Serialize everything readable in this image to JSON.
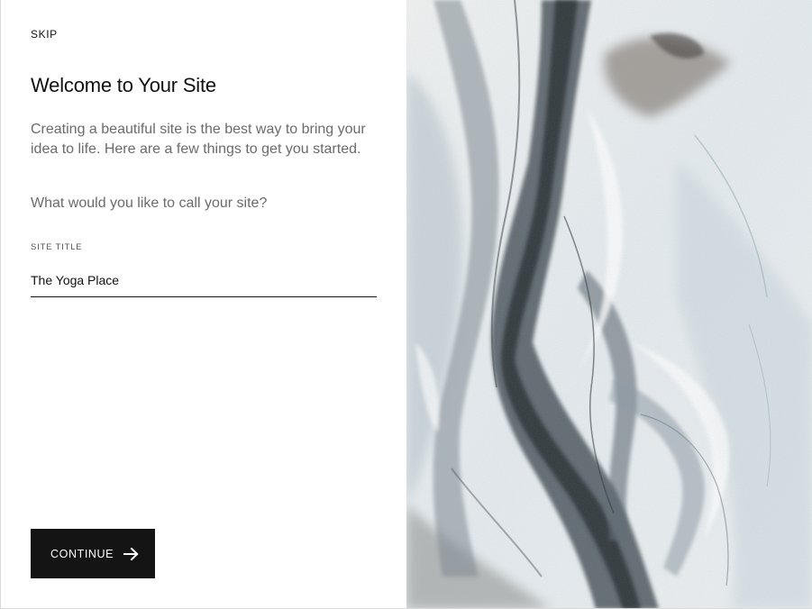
{
  "header": {
    "skip_label": "SKIP"
  },
  "intro": {
    "title": "Welcome to Your Site",
    "description": "Creating a beautiful site is the best way to bring your idea to life. Here are a few things to get you started.",
    "prompt": "What would you like to call your site?"
  },
  "form": {
    "site_title_label": "SITE TITLE",
    "site_title_value": "The Yoga Place"
  },
  "actions": {
    "continue_label": "CONTINUE"
  },
  "icons": {
    "continue_arrow": "arrow-right-icon"
  },
  "colors": {
    "button_background": "#141414",
    "body_text": "#6b6b6b",
    "heading_text": "#111111"
  }
}
